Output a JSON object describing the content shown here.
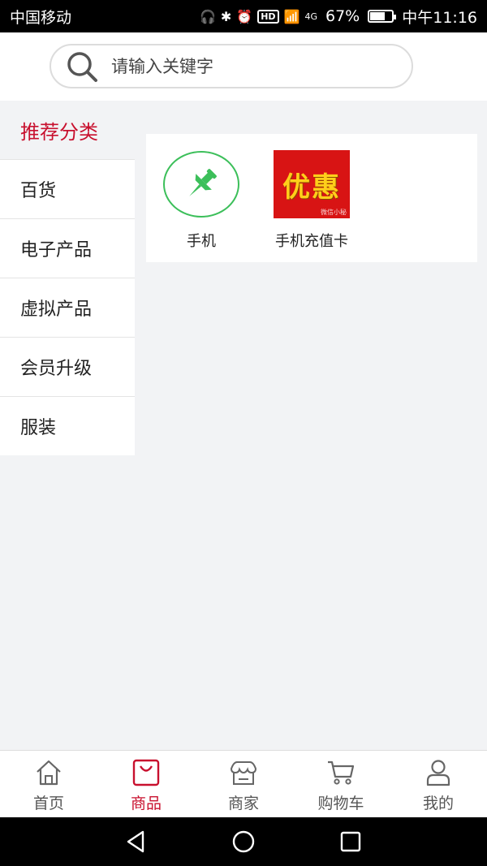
{
  "status_bar": {
    "carrier": "中国移动",
    "network": "4G",
    "hd": "HD",
    "battery": "67%",
    "battery_level": 0.67,
    "time": "中午11:16"
  },
  "search": {
    "placeholder": "请输入关键字"
  },
  "sidebar": {
    "title": "推荐分类",
    "items": [
      {
        "label": "百货"
      },
      {
        "label": "电子产品"
      },
      {
        "label": "虚拟产品"
      },
      {
        "label": "会员升级"
      },
      {
        "label": "服装"
      }
    ]
  },
  "categories": [
    {
      "label": "手机",
      "icon": "pin-icon"
    },
    {
      "label": "手机充值卡",
      "image_text": "优惠",
      "watermark": "微信小秘"
    }
  ],
  "tabbar": {
    "items": [
      {
        "label": "首页",
        "icon": "home-icon"
      },
      {
        "label": "商品",
        "icon": "bag-icon",
        "active": true
      },
      {
        "label": "商家",
        "icon": "store-icon"
      },
      {
        "label": "购物车",
        "icon": "cart-icon"
      },
      {
        "label": "我的",
        "icon": "user-icon"
      }
    ]
  },
  "colors": {
    "accent": "#c8102e",
    "pin_green": "#3cbf5a",
    "promo_red": "#d81414",
    "promo_text": "#ffcf1a"
  }
}
